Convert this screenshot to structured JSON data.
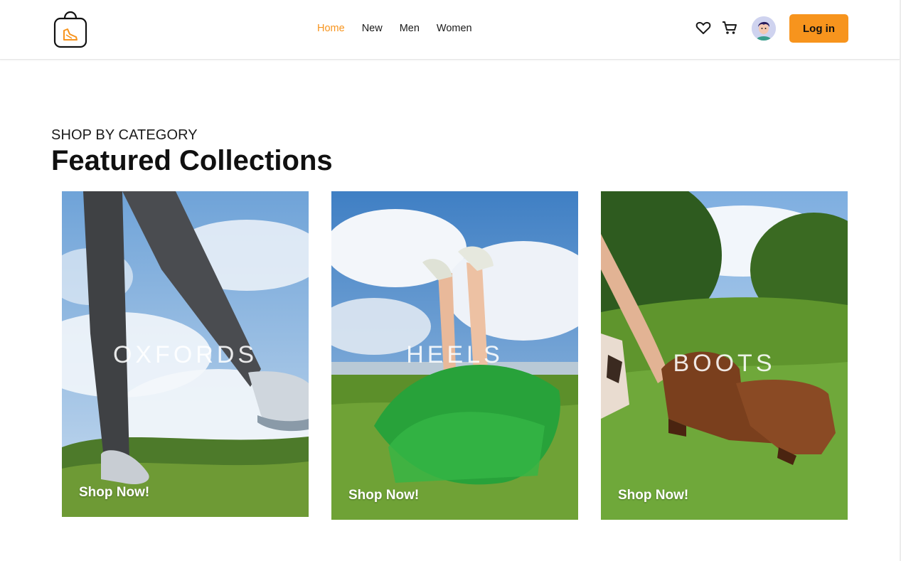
{
  "nav": {
    "items": [
      {
        "label": "Home",
        "active": true
      },
      {
        "label": "New",
        "active": false
      },
      {
        "label": "Men",
        "active": false
      },
      {
        "label": "Women",
        "active": false
      }
    ],
    "login_label": "Log in"
  },
  "icons": {
    "logo": "shopping-bag-shoe-icon",
    "wishlist": "heart-icon",
    "cart": "cart-icon",
    "avatar": "user-avatar"
  },
  "section": {
    "eyebrow": "SHOP BY CATEGORY",
    "title": "Featured Collections"
  },
  "collections": [
    {
      "name": "OXFORDS",
      "cta": "Shop Now!"
    },
    {
      "name": "HEELS",
      "cta": "Shop Now!"
    },
    {
      "name": "BOOTS",
      "cta": "Shop Now!"
    }
  ],
  "colors": {
    "accent": "#f7941d",
    "text": "#111111",
    "background": "#ffffff"
  }
}
